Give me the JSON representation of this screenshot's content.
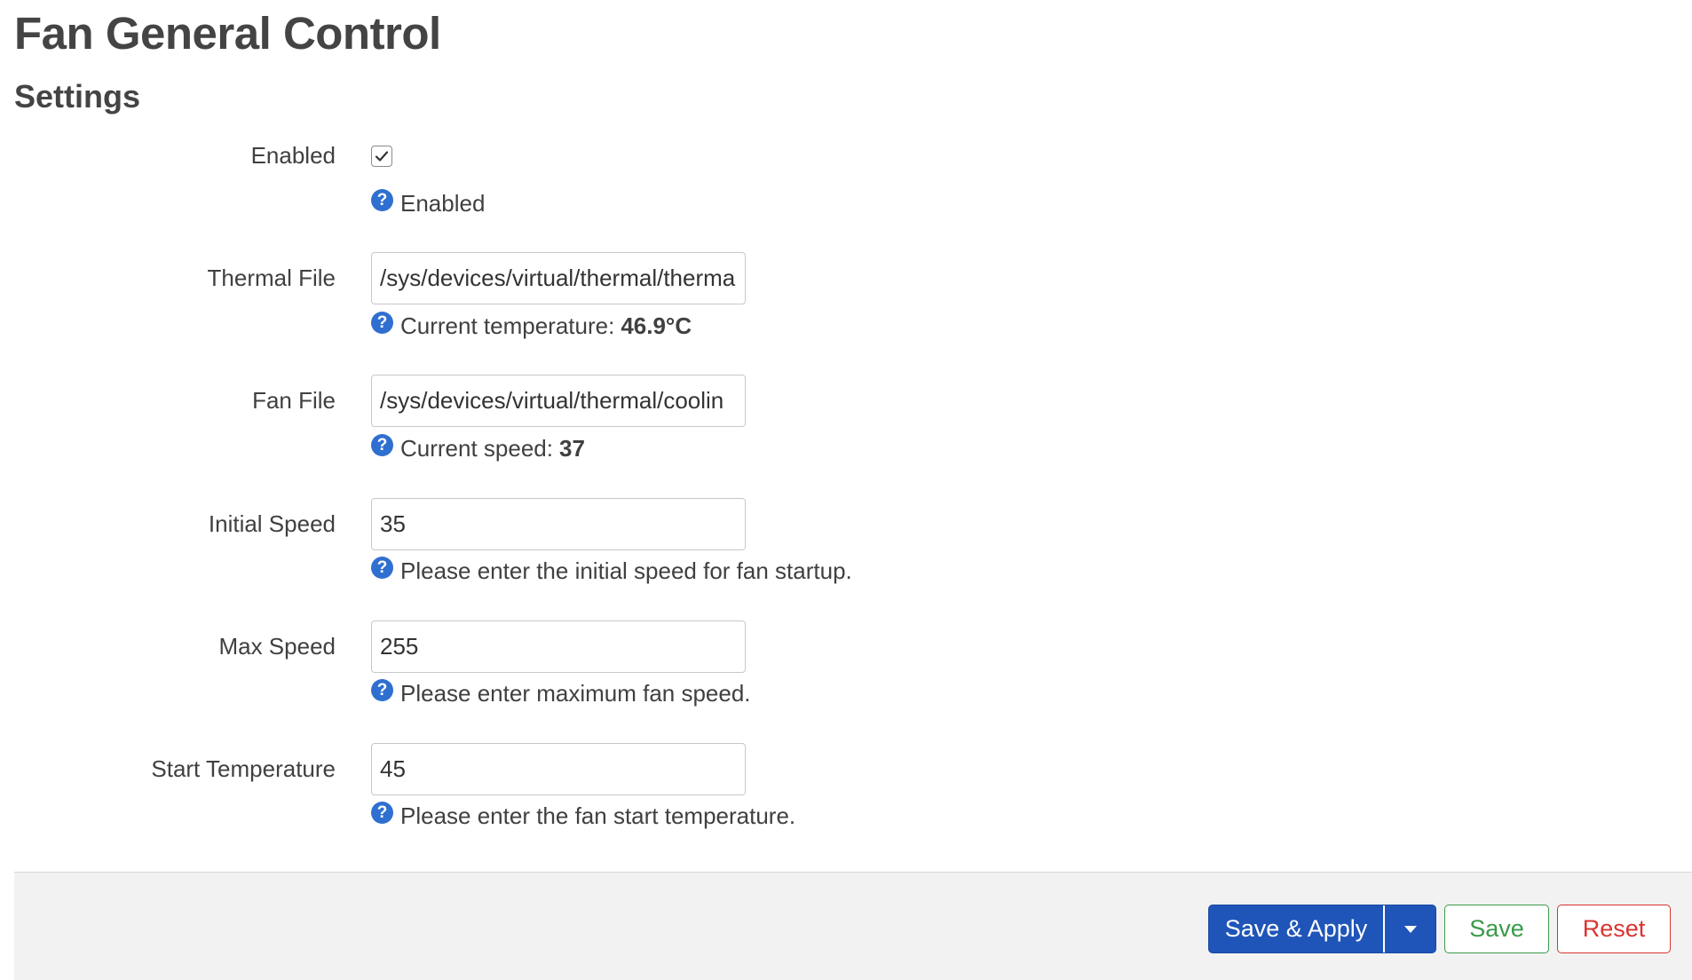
{
  "page": {
    "title": "Fan General Control",
    "section_title": "Settings"
  },
  "fields": {
    "enabled": {
      "label": "Enabled",
      "checked": true,
      "help": "Enabled"
    },
    "thermal_file": {
      "label": "Thermal File",
      "value": "/sys/devices/virtual/thermal/therma",
      "help": "Current temperature:",
      "help_value": "46.9°C"
    },
    "fan_file": {
      "label": "Fan File",
      "value": "/sys/devices/virtual/thermal/coolin",
      "help": "Current speed:",
      "help_value": "37"
    },
    "initial_speed": {
      "label": "Initial Speed",
      "value": "35",
      "help": "Please enter the initial speed for fan startup."
    },
    "max_speed": {
      "label": "Max Speed",
      "value": "255",
      "help": "Please enter maximum fan speed."
    },
    "start_temperature": {
      "label": "Start Temperature",
      "value": "45",
      "help": "Please enter the fan start temperature."
    }
  },
  "help_icon_glyph": "?",
  "footer": {
    "save_apply_label": "Save & Apply",
    "save_label": "Save",
    "reset_label": "Reset"
  },
  "colors": {
    "primary": "#1f55b8",
    "save": "#3a9a4a",
    "reset": "#d9352f",
    "help_icon": "#2f6fd0"
  },
  "icons": {
    "checkbox_mark": "check-icon",
    "help": "help-icon",
    "dropdown": "caret-down-icon"
  }
}
